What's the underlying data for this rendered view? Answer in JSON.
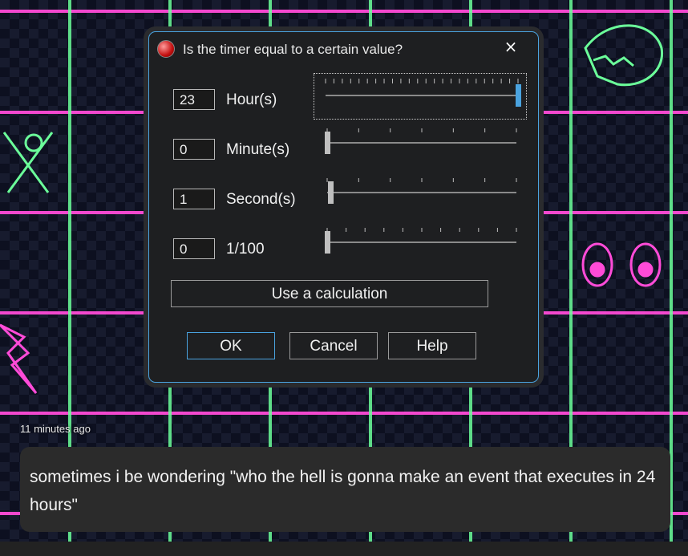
{
  "dialog": {
    "title": "Is the timer equal to a certain value?",
    "close_symbol": "×",
    "app_icon": "clickteam-red-gem-icon",
    "rows": [
      {
        "value": "23",
        "unit": "Hour(s)",
        "slider_fraction": 1.0,
        "max": 23
      },
      {
        "value": "0",
        "unit": "Minute(s)",
        "slider_fraction": 0.0,
        "max": 59
      },
      {
        "value": "1",
        "unit": "Second(s)",
        "slider_fraction": 0.017,
        "max": 59
      },
      {
        "value": "0",
        "unit": "1/100",
        "slider_fraction": 0.0,
        "max": 99
      }
    ],
    "calculation_button": "Use a calculation",
    "ok_button": "OK",
    "cancel_button": "Cancel",
    "help_button": "Help",
    "accent_color": "#4aa3df"
  },
  "message": {
    "timestamp": "11 minutes ago",
    "text": "sometimes i be wondering \"who the hell is gonna make an event that executes in 24 hours\"",
    "bubble_color": "#2b2b2b"
  },
  "background": {
    "grid_pink": "#ff4bd8",
    "grid_green": "#6bff9a",
    "decorations": [
      "neon-dinosaur-skull-icon",
      "neon-crossed-bones-icon",
      "neon-eyes-icon",
      "neon-lightning-icon"
    ]
  }
}
